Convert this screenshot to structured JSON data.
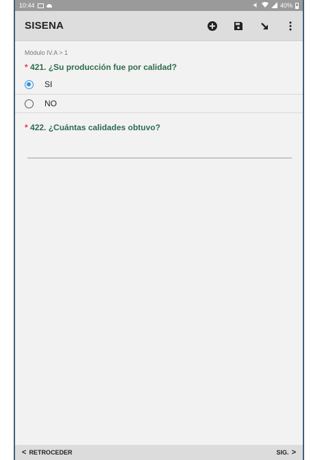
{
  "status_bar": {
    "time": "10:44",
    "right_text": "40%",
    "icons": [
      "image-icon",
      "cloud-icon",
      "mute-icon",
      "wifi-icon",
      "signal-icon",
      "battery-icon"
    ]
  },
  "app_bar": {
    "title": "SISENA",
    "actions": [
      "add-circle-icon",
      "save-icon",
      "arrow-down-right-icon",
      "more-vert-icon"
    ]
  },
  "breadcrumb": "Módulo IV.A > 1",
  "questions": [
    {
      "required": "*",
      "text": "421. ¿Su producción fue por calidad?",
      "options": [
        {
          "label": "SI",
          "checked": true
        },
        {
          "label": "NO",
          "checked": false
        }
      ]
    },
    {
      "required": "*",
      "text": "422. ¿Cuántas calidades obtuvo?",
      "value": ""
    }
  ],
  "bottom_bar": {
    "prev_icon": "<",
    "prev_label": "RETROCEDER",
    "next_label": "SIG.",
    "next_icon": ">"
  },
  "colors": {
    "accent": "#2e90e6",
    "question_text": "#2f6b4f",
    "required": "#e53935",
    "app_bar": "#dddddd"
  }
}
